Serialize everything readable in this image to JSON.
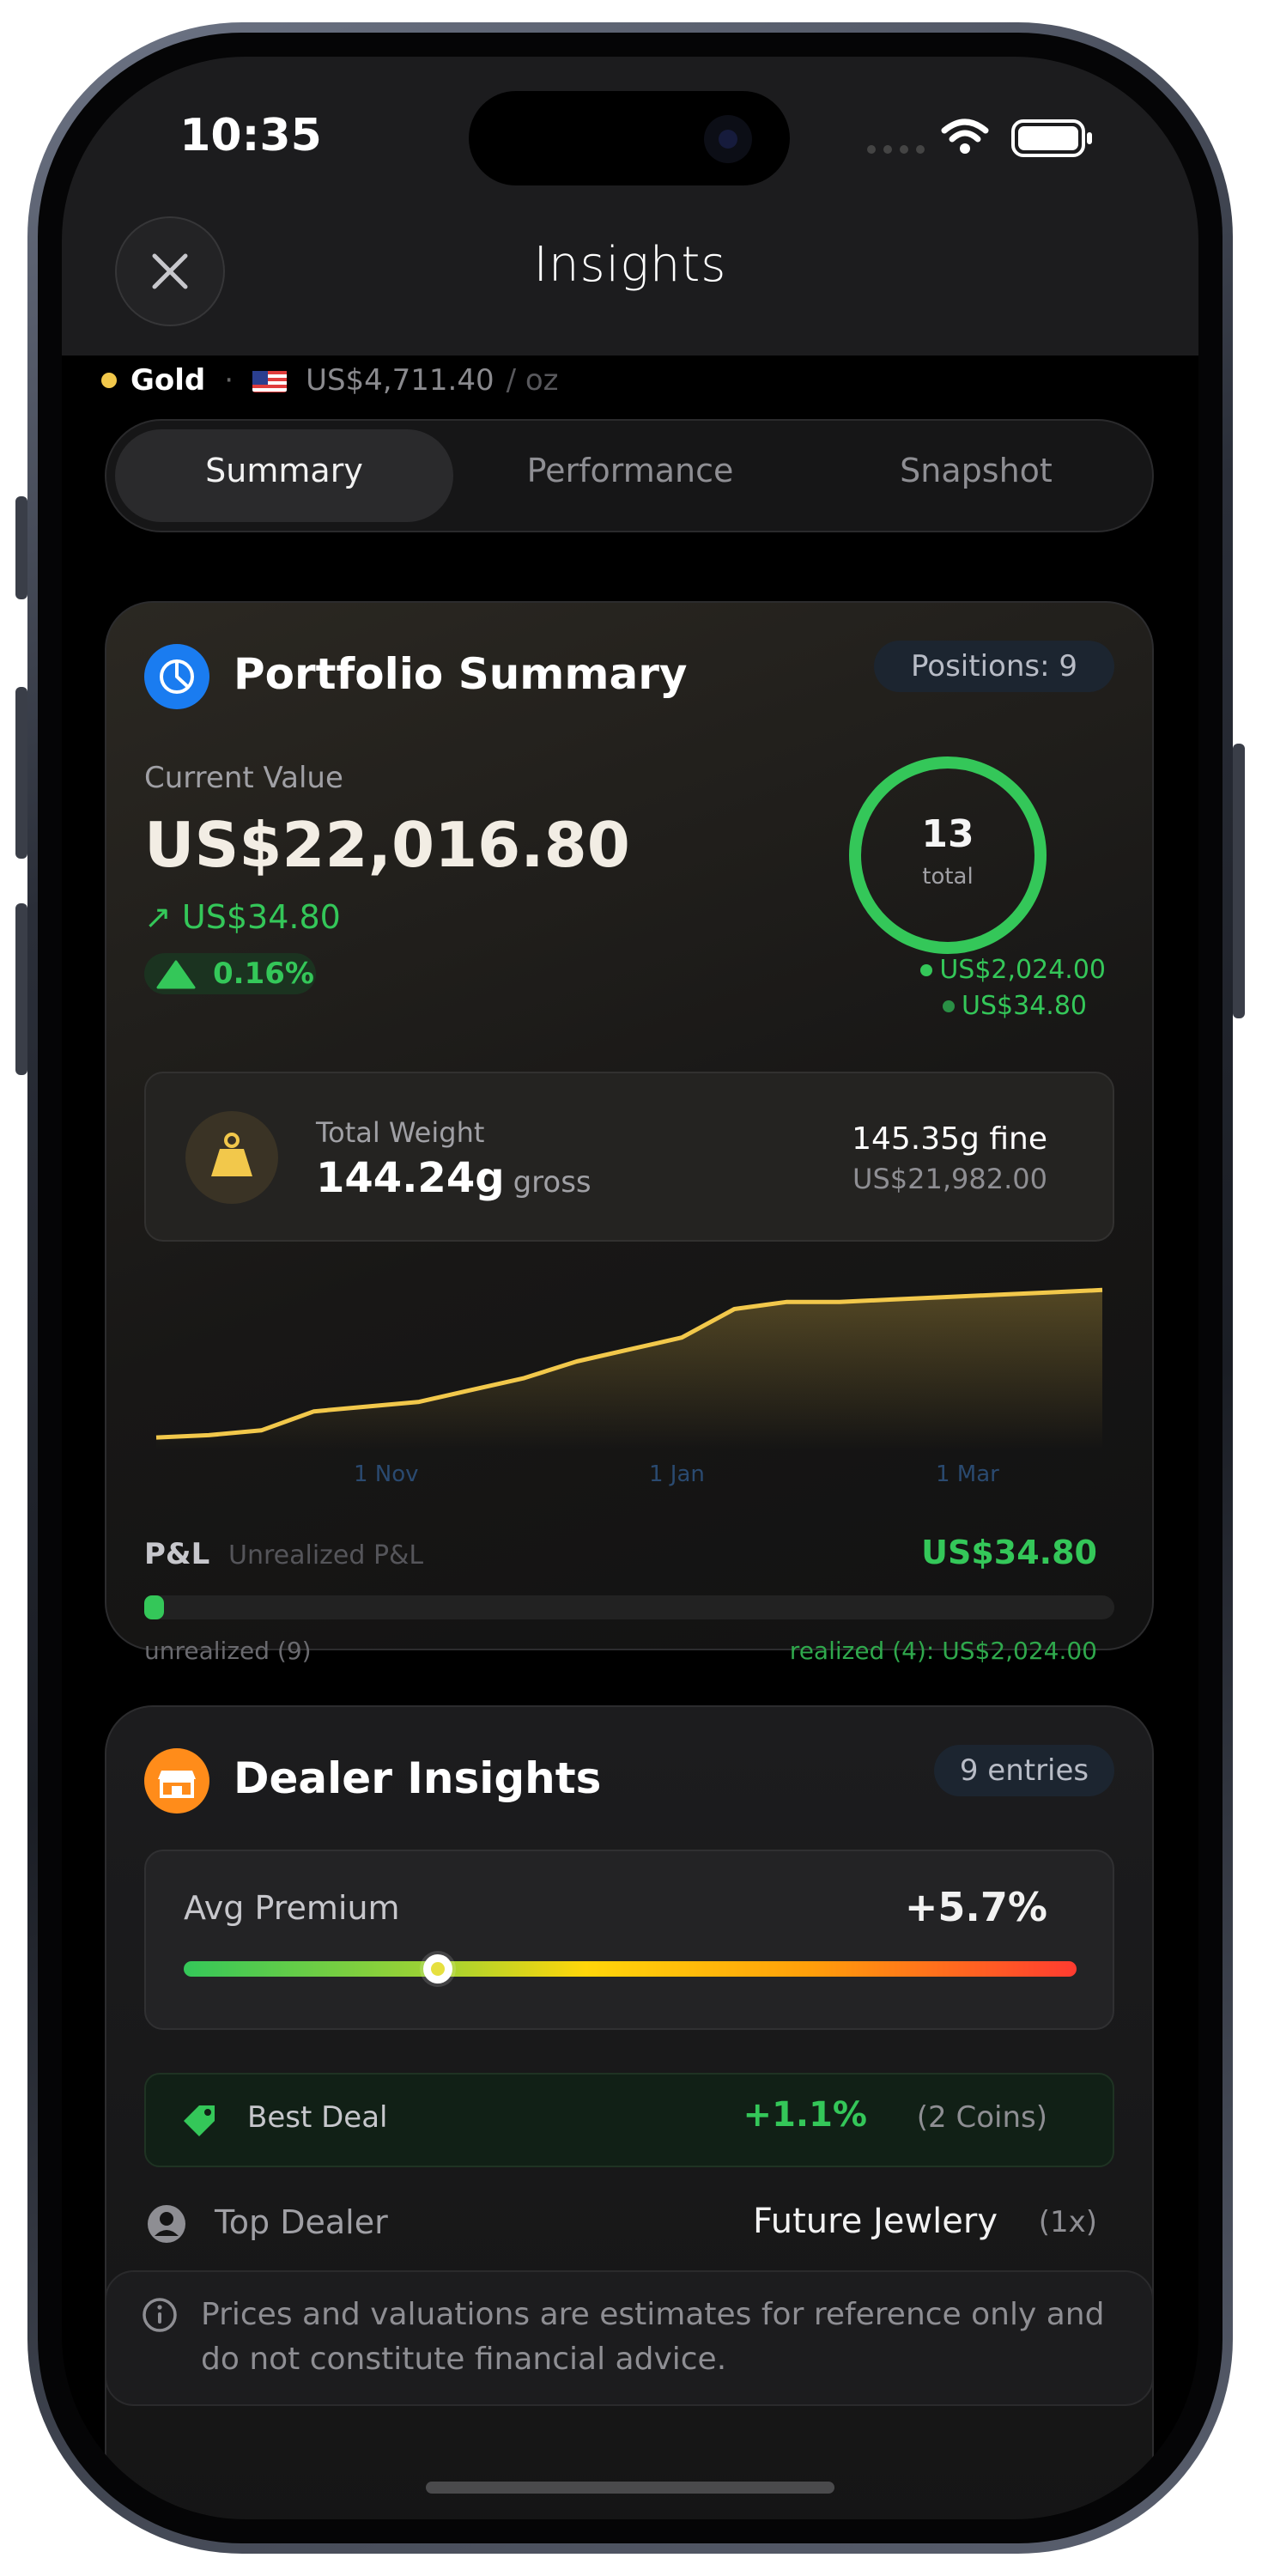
{
  "status_bar": {
    "time": "10:35"
  },
  "header": {
    "title": "Insights"
  },
  "ticker": {
    "metal": "Gold",
    "price": "US$4,711.40",
    "unit": "/ oz"
  },
  "tabs": [
    {
      "label": "Summary",
      "active": true
    },
    {
      "label": "Performance",
      "active": false
    },
    {
      "label": "Snapshot",
      "active": false
    }
  ],
  "portfolio": {
    "title": "Portfolio Summary",
    "positions": "Positions: 9",
    "current_value_label": "Current Value",
    "current_value": "US$22,016.80",
    "change_amount": "↗ US$34.80",
    "change_pct": "0.16%",
    "ring": {
      "total": "13",
      "total_label": "total",
      "line1": "US$2,024.00",
      "line2": "US$34.80"
    },
    "weight": {
      "label": "Total Weight",
      "gross_value": "144.24g",
      "gross_unit": "gross",
      "fine": "145.35g fine",
      "fine_value": "US$21,982.00"
    },
    "pl": {
      "label": "P&L",
      "sub": "Unrealized P&L",
      "value": "US$34.80",
      "unrealized_label": "unrealized (9)",
      "realized_label": "realized (4): US$2,024.00",
      "unrealized_fraction": 0.02
    }
  },
  "chart_data": {
    "type": "line",
    "x_ticks": [
      "1 Nov",
      "1 Jan",
      "1 Mar"
    ],
    "grid": false,
    "title": "",
    "series": [
      {
        "values": [
          5,
          6,
          8,
          16,
          18,
          20,
          25,
          30,
          37,
          42,
          47,
          59,
          62,
          62,
          63,
          64,
          65,
          66,
          67
        ]
      }
    ]
  },
  "dealer": {
    "title": "Dealer Insights",
    "entries": "9 entries",
    "avg_premium_label": "Avg Premium",
    "avg_premium": "+5.7%",
    "avg_premium_position": 0.285,
    "best_deal_label": "Best Deal",
    "best_deal_pct": "+1.1%",
    "best_deal_coins": "(2 Coins)",
    "top_dealer_label": "Top Dealer",
    "top_dealer_name": "Future Jewlery",
    "top_dealer_count": "(1x)"
  },
  "disclaimer": "Prices and valuations are estimates for reference only and do not constitute financial advice.",
  "colors": {
    "accent_green": "#34c759",
    "gold": "#f2c84b",
    "blue": "#1a7cf0",
    "orange": "#ff8c1a"
  }
}
